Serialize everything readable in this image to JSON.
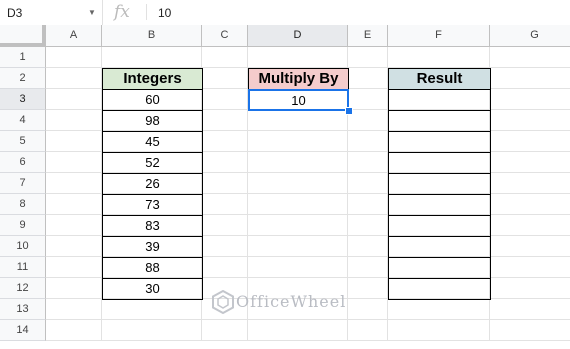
{
  "formula_bar": {
    "cell_ref": "D3",
    "fx": "fx",
    "value": "10"
  },
  "columns": [
    "A",
    "B",
    "C",
    "D",
    "E",
    "F",
    "G"
  ],
  "rows": [
    "1",
    "2",
    "3",
    "4",
    "5",
    "6",
    "7",
    "8",
    "9",
    "10",
    "11",
    "12",
    "13",
    "14"
  ],
  "headers": {
    "integers": "Integers",
    "multiply_by": "Multiply By",
    "result": "Result"
  },
  "multiply_value": "10",
  "integers": [
    "60",
    "98",
    "45",
    "52",
    "26",
    "73",
    "83",
    "39",
    "88",
    "30"
  ],
  "watermark": "OfficeWheel",
  "colors": {
    "integers_header": "#d9ead3",
    "multiply_header": "#f4cccc",
    "result_header": "#d0e0e3",
    "selection": "#1a73e8"
  }
}
